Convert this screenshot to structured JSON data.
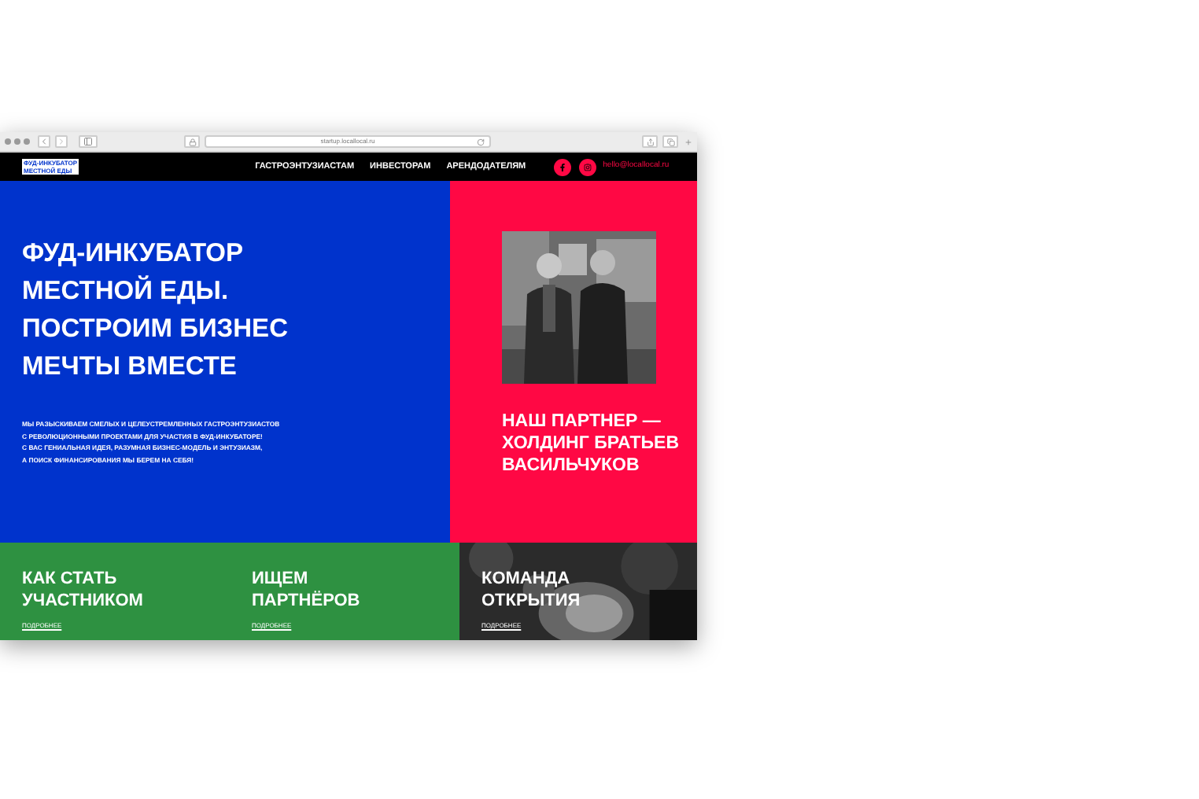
{
  "browser": {
    "url": "startup.locallocal.ru"
  },
  "navbar": {
    "logo": [
      "ФУД-ИНКУБАТОР",
      "МЕСТНОЙ ЕДЫ"
    ],
    "links": [
      "ГАСТРОЭНТУЗИАСТАМ",
      "ИНВЕСТОРАМ",
      "АРЕНДОДАТЕЛЯМ"
    ],
    "social": [
      {
        "kind": "facebook"
      },
      {
        "kind": "instagram"
      }
    ],
    "email": "hello@locallocal.ru"
  },
  "hero": {
    "title": [
      "ФУД-ИНКУБАТОР",
      "МЕСТНОЙ ЕДЫ.",
      "ПОСТРОИМ БИЗНЕС",
      "МЕЧТЫ ВМЕСТЕ"
    ],
    "text": [
      "МЫ РАЗЫСКИВАЕМ СМЕЛЫХ И ЦЕЛЕУСТРЕМЛЕННЫХ ГАСТРОЭНТУЗИАСТОВ",
      "С РЕВОЛЮЦИОННЫМИ ПРОЕКТАМИ ДЛЯ УЧАСТИЯ В ФУД-ИНКУБАТОРЕ!",
      "С ВАС ГЕНИАЛЬНАЯ ИДЕЯ, РАЗУМНАЯ БИЗНЕС-МОДЕЛЬ И ЭНТУЗИАЗМ,",
      "А ПОИСК ФИНАНСИРОВАНИЯ МЫ БЕРЕМ НА СЕБЯ!"
    ]
  },
  "partner": {
    "title": [
      "НАШ ПАРТНЕР —",
      "ХОЛДИНГ БРАТЬЕВ",
      "ВАСИЛЬЧУКОВ"
    ]
  },
  "cards": [
    {
      "title": [
        "КАК СТАТЬ",
        "УЧАСТНИКОМ"
      ],
      "link": "ПОДРОБНЕЕ",
      "kind": "green"
    },
    {
      "title": [
        "ИЩЕМ",
        "ПАРТНЁРОВ"
      ],
      "link": "ПОДРОБНЕЕ",
      "kind": "green"
    },
    {
      "title": [
        "КОМАНДА",
        "ОТКРЫТИЯ"
      ],
      "link": "ПОДРОБНЕЕ"
    }
  ]
}
